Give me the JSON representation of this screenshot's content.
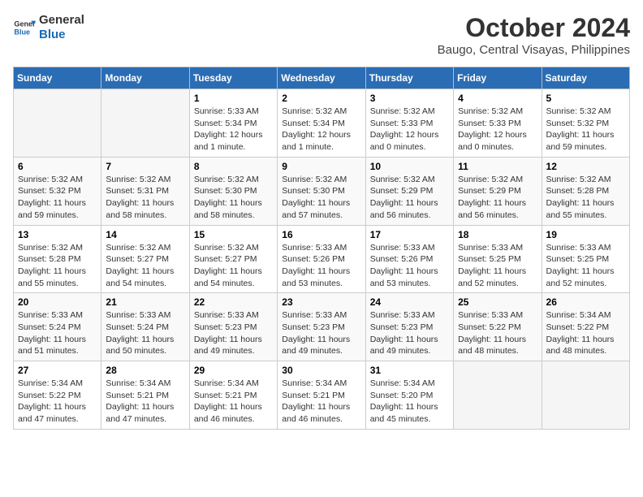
{
  "logo": {
    "line1": "General",
    "line2": "Blue"
  },
  "title": "October 2024",
  "location": "Baugo, Central Visayas, Philippines",
  "days_of_week": [
    "Sunday",
    "Monday",
    "Tuesday",
    "Wednesday",
    "Thursday",
    "Friday",
    "Saturday"
  ],
  "weeks": [
    [
      {
        "num": "",
        "info": ""
      },
      {
        "num": "",
        "info": ""
      },
      {
        "num": "1",
        "info": "Sunrise: 5:33 AM\nSunset: 5:34 PM\nDaylight: 12 hours\nand 1 minute."
      },
      {
        "num": "2",
        "info": "Sunrise: 5:32 AM\nSunset: 5:34 PM\nDaylight: 12 hours\nand 1 minute."
      },
      {
        "num": "3",
        "info": "Sunrise: 5:32 AM\nSunset: 5:33 PM\nDaylight: 12 hours\nand 0 minutes."
      },
      {
        "num": "4",
        "info": "Sunrise: 5:32 AM\nSunset: 5:33 PM\nDaylight: 12 hours\nand 0 minutes."
      },
      {
        "num": "5",
        "info": "Sunrise: 5:32 AM\nSunset: 5:32 PM\nDaylight: 11 hours\nand 59 minutes."
      }
    ],
    [
      {
        "num": "6",
        "info": "Sunrise: 5:32 AM\nSunset: 5:32 PM\nDaylight: 11 hours\nand 59 minutes."
      },
      {
        "num": "7",
        "info": "Sunrise: 5:32 AM\nSunset: 5:31 PM\nDaylight: 11 hours\nand 58 minutes."
      },
      {
        "num": "8",
        "info": "Sunrise: 5:32 AM\nSunset: 5:30 PM\nDaylight: 11 hours\nand 58 minutes."
      },
      {
        "num": "9",
        "info": "Sunrise: 5:32 AM\nSunset: 5:30 PM\nDaylight: 11 hours\nand 57 minutes."
      },
      {
        "num": "10",
        "info": "Sunrise: 5:32 AM\nSunset: 5:29 PM\nDaylight: 11 hours\nand 56 minutes."
      },
      {
        "num": "11",
        "info": "Sunrise: 5:32 AM\nSunset: 5:29 PM\nDaylight: 11 hours\nand 56 minutes."
      },
      {
        "num": "12",
        "info": "Sunrise: 5:32 AM\nSunset: 5:28 PM\nDaylight: 11 hours\nand 55 minutes."
      }
    ],
    [
      {
        "num": "13",
        "info": "Sunrise: 5:32 AM\nSunset: 5:28 PM\nDaylight: 11 hours\nand 55 minutes."
      },
      {
        "num": "14",
        "info": "Sunrise: 5:32 AM\nSunset: 5:27 PM\nDaylight: 11 hours\nand 54 minutes."
      },
      {
        "num": "15",
        "info": "Sunrise: 5:32 AM\nSunset: 5:27 PM\nDaylight: 11 hours\nand 54 minutes."
      },
      {
        "num": "16",
        "info": "Sunrise: 5:33 AM\nSunset: 5:26 PM\nDaylight: 11 hours\nand 53 minutes."
      },
      {
        "num": "17",
        "info": "Sunrise: 5:33 AM\nSunset: 5:26 PM\nDaylight: 11 hours\nand 53 minutes."
      },
      {
        "num": "18",
        "info": "Sunrise: 5:33 AM\nSunset: 5:25 PM\nDaylight: 11 hours\nand 52 minutes."
      },
      {
        "num": "19",
        "info": "Sunrise: 5:33 AM\nSunset: 5:25 PM\nDaylight: 11 hours\nand 52 minutes."
      }
    ],
    [
      {
        "num": "20",
        "info": "Sunrise: 5:33 AM\nSunset: 5:24 PM\nDaylight: 11 hours\nand 51 minutes."
      },
      {
        "num": "21",
        "info": "Sunrise: 5:33 AM\nSunset: 5:24 PM\nDaylight: 11 hours\nand 50 minutes."
      },
      {
        "num": "22",
        "info": "Sunrise: 5:33 AM\nSunset: 5:23 PM\nDaylight: 11 hours\nand 49 minutes."
      },
      {
        "num": "23",
        "info": "Sunrise: 5:33 AM\nSunset: 5:23 PM\nDaylight: 11 hours\nand 49 minutes."
      },
      {
        "num": "24",
        "info": "Sunrise: 5:33 AM\nSunset: 5:23 PM\nDaylight: 11 hours\nand 49 minutes."
      },
      {
        "num": "25",
        "info": "Sunrise: 5:33 AM\nSunset: 5:22 PM\nDaylight: 11 hours\nand 48 minutes."
      },
      {
        "num": "26",
        "info": "Sunrise: 5:34 AM\nSunset: 5:22 PM\nDaylight: 11 hours\nand 48 minutes."
      }
    ],
    [
      {
        "num": "27",
        "info": "Sunrise: 5:34 AM\nSunset: 5:22 PM\nDaylight: 11 hours\nand 47 minutes."
      },
      {
        "num": "28",
        "info": "Sunrise: 5:34 AM\nSunset: 5:21 PM\nDaylight: 11 hours\nand 47 minutes."
      },
      {
        "num": "29",
        "info": "Sunrise: 5:34 AM\nSunset: 5:21 PM\nDaylight: 11 hours\nand 46 minutes."
      },
      {
        "num": "30",
        "info": "Sunrise: 5:34 AM\nSunset: 5:21 PM\nDaylight: 11 hours\nand 46 minutes."
      },
      {
        "num": "31",
        "info": "Sunrise: 5:34 AM\nSunset: 5:20 PM\nDaylight: 11 hours\nand 45 minutes."
      },
      {
        "num": "",
        "info": ""
      },
      {
        "num": "",
        "info": ""
      }
    ]
  ]
}
